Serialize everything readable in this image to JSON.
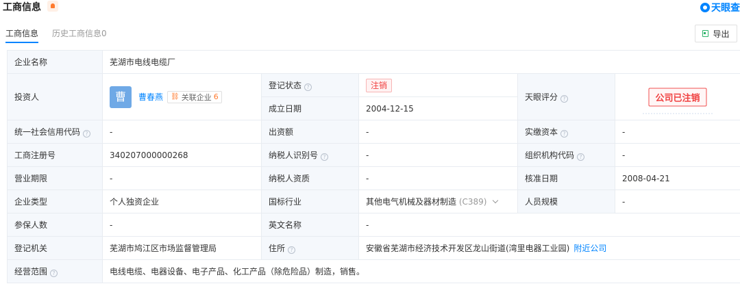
{
  "header": {
    "title": "工商信息",
    "brand": "天眼查"
  },
  "tabs": {
    "active": "工商信息",
    "history": "历史工商信息0"
  },
  "export_label": "导出",
  "row1": {
    "label": "企业名称",
    "value": "芜湖市电线电缆厂"
  },
  "investor": {
    "label": "投资人",
    "avatar": "曹",
    "name": "曹春燕",
    "assoc_label": "关联企业",
    "assoc_count": "6"
  },
  "status": {
    "label": "登记状态",
    "value": "注销"
  },
  "founded": {
    "label": "成立日期",
    "value": "2004-12-15"
  },
  "score": {
    "label": "天眼评分",
    "stamp": "公司已注销"
  },
  "credit_code": {
    "label": "统一社会信用代码",
    "value": "-"
  },
  "contribution": {
    "label": "出资额",
    "value": "-"
  },
  "paid_capital": {
    "label": "实缴资本",
    "value": "-"
  },
  "reg_no": {
    "label": "工商注册号",
    "value": "340207000000268"
  },
  "taxpayer_id": {
    "label": "纳税人识别号",
    "value": "-"
  },
  "org_code": {
    "label": "组织机构代码",
    "value": "-"
  },
  "term": {
    "label": "营业期限",
    "value": "-"
  },
  "taxpayer_qual": {
    "label": "纳税人资质",
    "value": "-"
  },
  "approval_date": {
    "label": "核准日期",
    "value": "2008-04-21"
  },
  "company_type": {
    "label": "企业类型",
    "value": "个人独资企业"
  },
  "industry": {
    "label": "国标行业",
    "value": "其他电气机械及器材制造",
    "code": "(C389)"
  },
  "staff_size": {
    "label": "人员规模",
    "value": "-"
  },
  "insured": {
    "label": "参保人数",
    "value": "-"
  },
  "english_name": {
    "label": "英文名称",
    "value": "-"
  },
  "authority": {
    "label": "登记机关",
    "value": "芜湖市鸠江区市场监督管理局"
  },
  "address": {
    "label": "住所",
    "value": "安徽省芜湖市经济技术开发区龙山街道(湾里电器工业园)",
    "link": "附近公司"
  },
  "scope": {
    "label": "经营范围",
    "value": "电线电缆、电器设备、电子产品、化工产品（除危险品）制造，销售。"
  },
  "colors": {
    "accent": "#0084ff",
    "danger": "#f04040",
    "label_bg": "#f5f8fc",
    "border": "#e8ecf1"
  },
  "icons": [
    "bell-icon",
    "tianyancha-logo-icon",
    "export-icon",
    "help-icon",
    "link-icon",
    "chevron-down-icon"
  ]
}
